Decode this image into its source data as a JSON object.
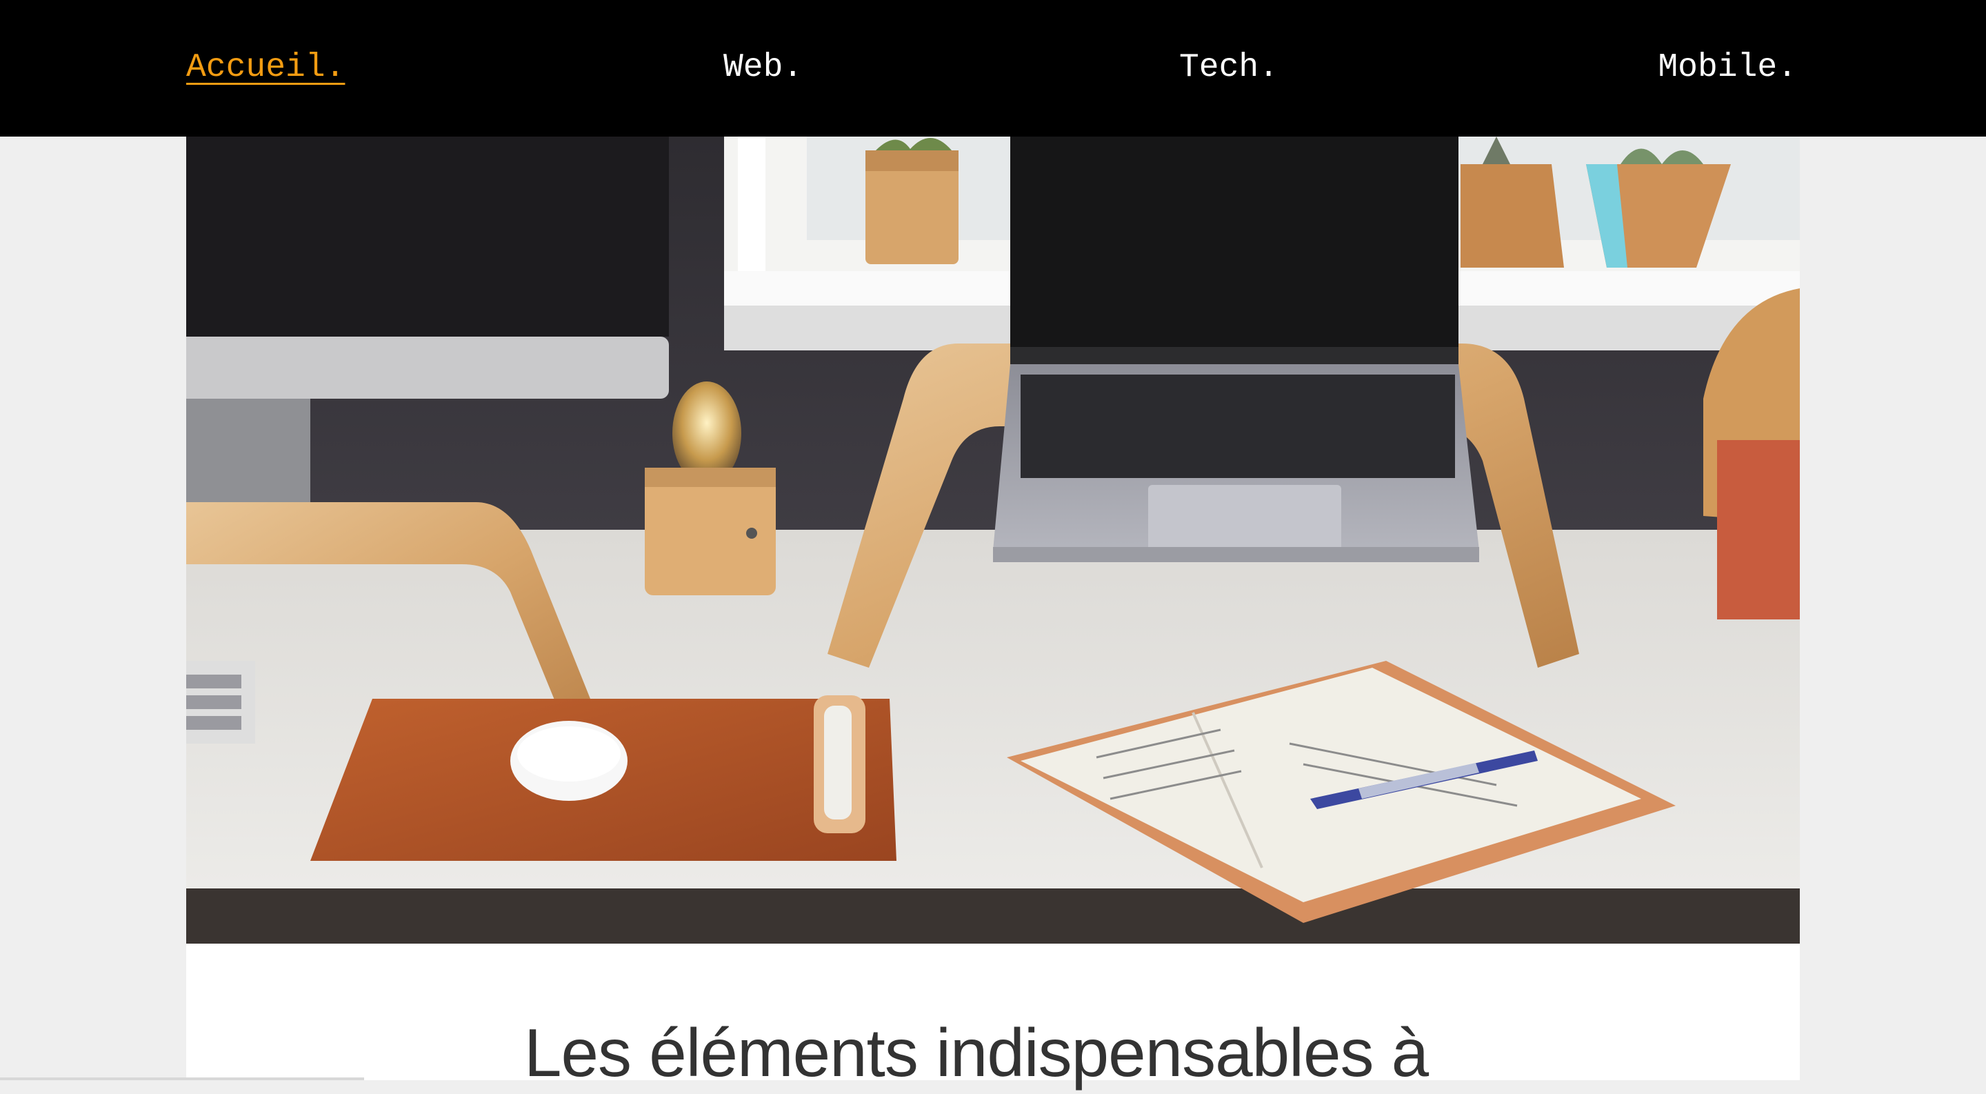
{
  "nav": {
    "items": [
      {
        "label": "Accueil.",
        "active": true
      },
      {
        "label": "Web.",
        "active": false
      },
      {
        "label": "Tech.",
        "active": false
      },
      {
        "label": "Mobile.",
        "active": false
      }
    ],
    "active_color": "#f39c12",
    "background": "#000000"
  },
  "article": {
    "title": "Les éléments indispensables à"
  },
  "hero_image": {
    "icons": [
      "desktop-monitor-icon",
      "laptop-icon",
      "wooden-stand-icon",
      "desk-lamp-icon",
      "mouse-icon",
      "notebook-icon",
      "pen-icon",
      "plant-icon",
      "speaker-icon"
    ]
  }
}
